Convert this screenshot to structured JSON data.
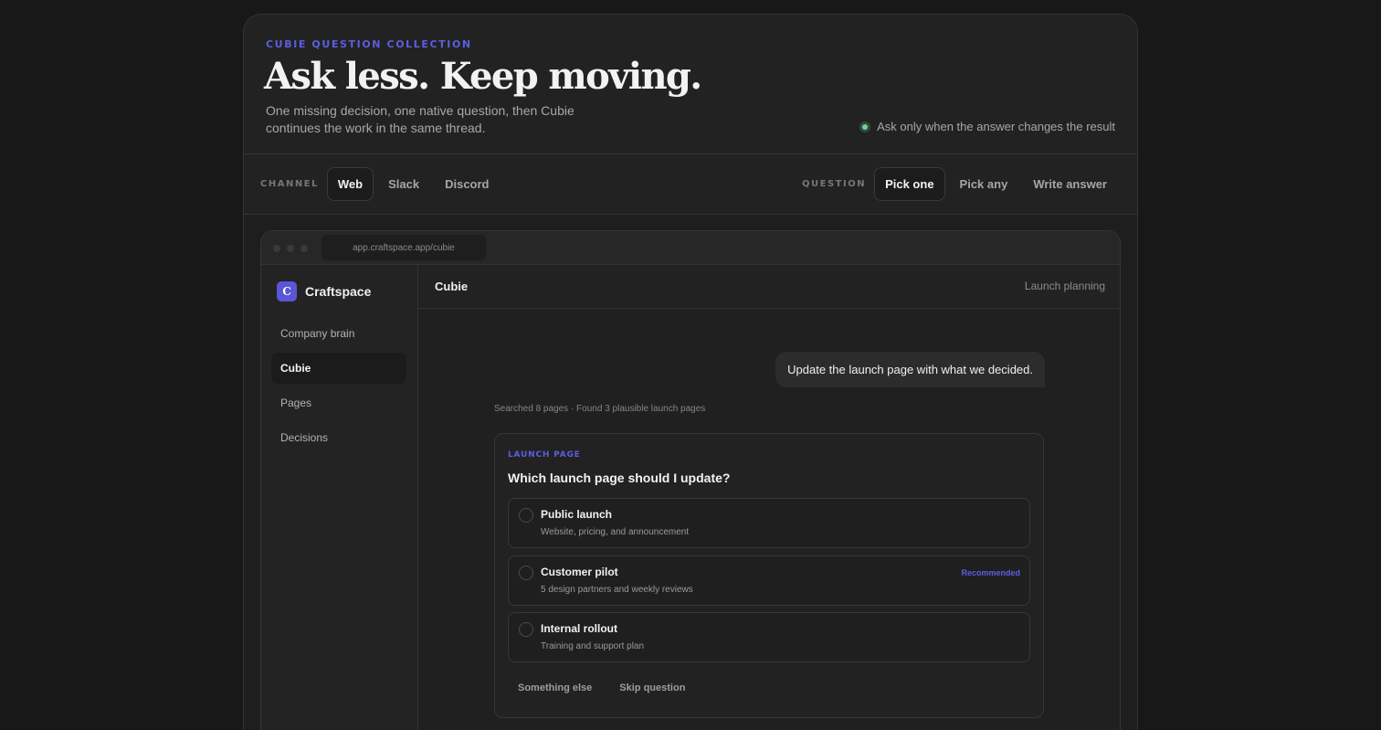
{
  "hero": {
    "eyebrow": "CUBIE QUESTION COLLECTION",
    "headline": "Ask less. Keep moving.",
    "subtext": "One missing decision, one native question, then Cubie continues the work in the same thread.",
    "rule": "Ask only when the answer changes the result"
  },
  "controls": {
    "channel_label": "CHANNEL",
    "channels": [
      {
        "label": "Web",
        "active": true
      },
      {
        "label": "Slack",
        "active": false
      },
      {
        "label": "Discord",
        "active": false
      }
    ],
    "question_label": "QUESTION",
    "question_types": [
      {
        "label": "Pick one",
        "active": true
      },
      {
        "label": "Pick any",
        "active": false
      },
      {
        "label": "Write answer",
        "active": false
      }
    ]
  },
  "browser": {
    "url": "app.craftspace.app/cubie"
  },
  "sidebar": {
    "brand_initial": "C",
    "brand_name": "Craftspace",
    "items": [
      {
        "label": "Company brain",
        "active": false
      },
      {
        "label": "Cubie",
        "active": true
      },
      {
        "label": "Pages",
        "active": false
      },
      {
        "label": "Decisions",
        "active": false
      }
    ]
  },
  "main": {
    "title": "Cubie",
    "context": "Launch planning",
    "user_message": "Update the launch page with what we decided.",
    "search_meta": "Searched 8 pages · Found 3 plausible launch pages"
  },
  "question_card": {
    "eyebrow": "LAUNCH PAGE",
    "question": "Which launch page should I update?",
    "options": [
      {
        "title": "Public launch",
        "description": "Website, pricing, and announcement",
        "badge": ""
      },
      {
        "title": "Customer pilot",
        "description": "5 design partners and weekly reviews",
        "badge": "Recommended"
      },
      {
        "title": "Internal rollout",
        "description": "Training and support plan",
        "badge": ""
      }
    ],
    "something_else": "Something else",
    "skip": "Skip question"
  },
  "colors": {
    "accent": "#5b5fe0",
    "status_green": "#6fd39a",
    "background": "#181818"
  }
}
